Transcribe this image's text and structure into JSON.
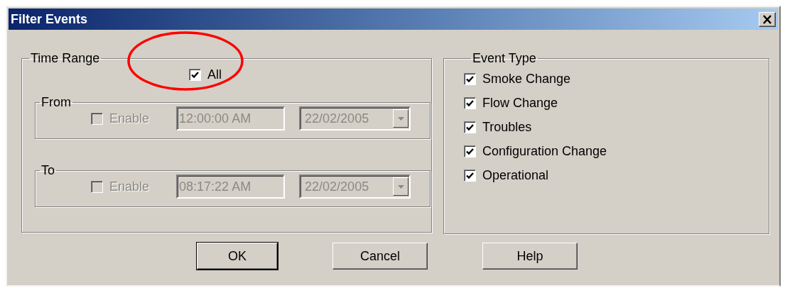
{
  "window": {
    "title": "Filter Events"
  },
  "time_range": {
    "label": "Time Range",
    "all": {
      "label": "All",
      "checked": true
    },
    "ranges": [
      {
        "label": "From",
        "disabled": true,
        "enable": {
          "label": "Enable",
          "checked": false
        },
        "time": "12:00:00 AM",
        "date": "22/02/2005"
      },
      {
        "label": "To",
        "disabled": true,
        "enable": {
          "label": "Enable",
          "checked": false
        },
        "time": "08:17:22 AM",
        "date": "22/02/2005"
      }
    ]
  },
  "event_type": {
    "label": "Event Type",
    "items": [
      {
        "label": "Smoke Change",
        "checked": true
      },
      {
        "label": "Flow Change",
        "checked": true
      },
      {
        "label": "Troubles",
        "checked": true
      },
      {
        "label": "Configuration Change",
        "checked": true
      },
      {
        "label": "Operational",
        "checked": true
      }
    ]
  },
  "buttons": [
    {
      "label": "OK",
      "default": true
    },
    {
      "label": "Cancel",
      "default": false
    },
    {
      "label": "Help",
      "default": false
    }
  ]
}
